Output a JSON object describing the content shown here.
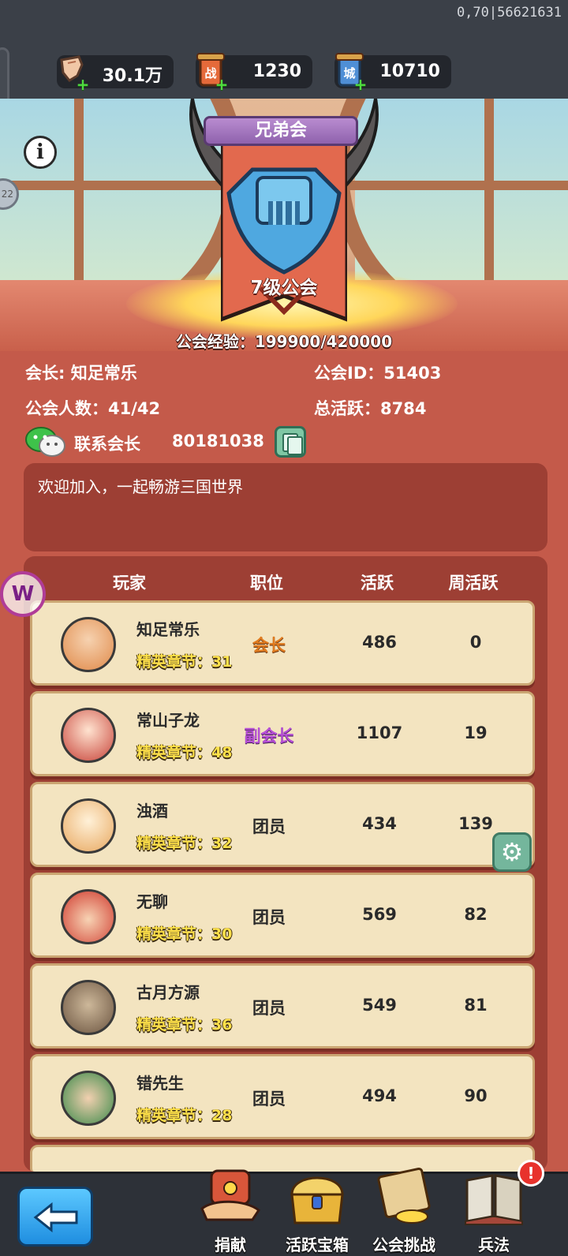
{
  "debug": {
    "text": "0,70|56621631"
  },
  "resources": [
    {
      "name": "hand-resource",
      "value": "30.1万"
    },
    {
      "name": "battle-token",
      "value": "1230",
      "icon_text": "战"
    },
    {
      "name": "city-token",
      "value": "10710",
      "icon_text": "城"
    }
  ],
  "guild": {
    "name": "兄弟会",
    "level": "7级公会",
    "exp": "公会经验：199900/420000",
    "leader_label": "会长: 知足常乐",
    "id_label": "公会ID：51403",
    "members_label": "公会人数：41/42",
    "total_active_label": "总活跃：8784",
    "contact_label": "联系会长",
    "contact_number": "80181038",
    "notice": "欢迎加入，一起畅游三国世界"
  },
  "table": {
    "headers": {
      "player": "玩家",
      "role": "职位",
      "active": "活跃",
      "weekly": "周活跃"
    },
    "rows": [
      {
        "name": "知足常乐",
        "chapter": "精英章节：31",
        "role": "会长",
        "role_type": "leader",
        "active": "486",
        "weekly": "0"
      },
      {
        "name": "常山子龙",
        "chapter": "精英章节：48",
        "role": "副会长",
        "role_type": "vice",
        "active": "1107",
        "weekly": "19"
      },
      {
        "name": "浊酒",
        "chapter": "精英章节：32",
        "role": "团员",
        "role_type": "member",
        "active": "434",
        "weekly": "139"
      },
      {
        "name": "无聊",
        "chapter": "精英章节：30",
        "role": "团员",
        "role_type": "member",
        "active": "569",
        "weekly": "82"
      },
      {
        "name": "古月方源",
        "chapter": "精英章节：36",
        "role": "团员",
        "role_type": "member",
        "active": "549",
        "weekly": "81"
      },
      {
        "name": "错先生",
        "chapter": "精英章节：28",
        "role": "团员",
        "role_type": "member",
        "active": "494",
        "weekly": "90"
      }
    ]
  },
  "bottom": {
    "donate": "捐献",
    "chest": "活跃宝箱",
    "challenge": "公会挑战",
    "tactics": "兵法",
    "badge": "!"
  },
  "colors": {
    "panel": "#c45a4a",
    "row_bg": "#f3e4c0",
    "chapter": "#ffe14a",
    "leader": "#e07b1f",
    "vice": "#b64fd6"
  }
}
